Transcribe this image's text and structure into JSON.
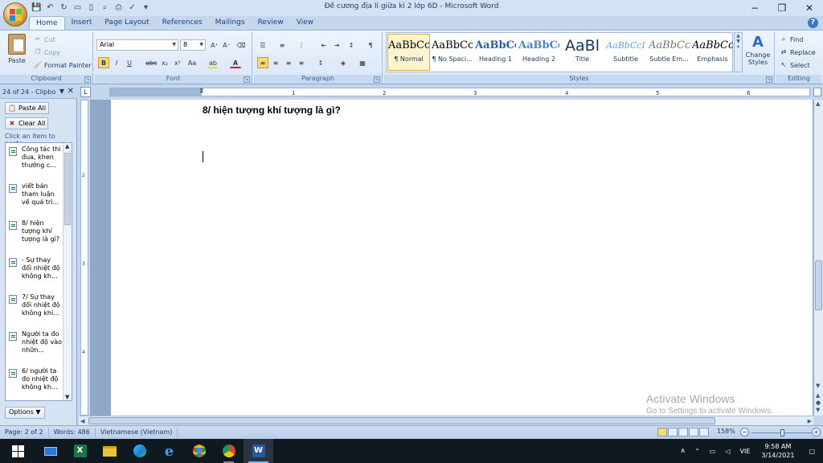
{
  "window": {
    "title": "Đề cương địa lí giữa kì 2 lớp 6D - Microsoft Word"
  },
  "tabs": [
    {
      "label": "Home"
    },
    {
      "label": "Insert"
    },
    {
      "label": "Page Layout"
    },
    {
      "label": "References"
    },
    {
      "label": "Mailings"
    },
    {
      "label": "Review"
    },
    {
      "label": "View"
    }
  ],
  "clipboard_group": {
    "label": "Clipboard",
    "paste": "Paste",
    "cut": "Cut",
    "copy": "Copy",
    "format_painter": "Format Painter"
  },
  "font_group": {
    "label": "Font",
    "font_name": "Arial",
    "font_size": "8"
  },
  "paragraph_group": {
    "label": "Paragraph"
  },
  "styles_group": {
    "label": "Styles",
    "items": [
      {
        "preview": "AaBbCcI",
        "name": "¶ Normal"
      },
      {
        "preview": "AaBbCcI",
        "name": "¶ No Spaci..."
      },
      {
        "preview": "AaBbCc",
        "name": "Heading 1"
      },
      {
        "preview": "AaBbCc",
        "name": "Heading 2"
      },
      {
        "preview": "AaBl",
        "name": "Title"
      },
      {
        "preview": "AaBbCcI",
        "name": "Subtitle"
      },
      {
        "preview": "AaBbCcI",
        "name": "Subtle Em..."
      },
      {
        "preview": "AaBbCcI",
        "name": "Emphasis"
      }
    ],
    "change_styles": "Change Styles"
  },
  "editing_group": {
    "label": "Editing",
    "find": "Find",
    "replace": "Replace",
    "select": "Select"
  },
  "clipboard_pane": {
    "title": "24 of 24 - Clipbo",
    "paste_all": "Paste All",
    "clear_all": "Clear All",
    "hint": "Click an item to paste:",
    "items": [
      {
        "text": "Công tác thi đua, khen thưởng c..."
      },
      {
        "text": "viết bản tham luận về quá trì..."
      },
      {
        "text": "8/ hiện tượng khí tượng là gì?"
      },
      {
        "text": "- Sự thay đổi nhiệt độ không kh..."
      },
      {
        "text": "7/ Sự thay đổi nhiệt độ không khí..."
      },
      {
        "text": "Người ta đo nhiệt độ vào nhữn..."
      },
      {
        "text": "6/ người ta đo nhiệt độ không kh..."
      }
    ],
    "options": "Options"
  },
  "document": {
    "heading": "8/ hiện tượng khí tượng là gì?"
  },
  "ruler": {
    "ticks": [
      "1",
      "2",
      "3",
      "4",
      "5",
      "6"
    ]
  },
  "watermark": {
    "line1": "Activate Windows",
    "line2": "Go to Settings to activate Windows."
  },
  "status": {
    "page": "Page: 2 of 2",
    "words": "Words: 486",
    "language": "Vietnamese (Vietnam)",
    "zoom": "158%"
  },
  "taskbar": {
    "lang": "VIE",
    "time": "9:58 AM",
    "date": "3/14/2021"
  }
}
